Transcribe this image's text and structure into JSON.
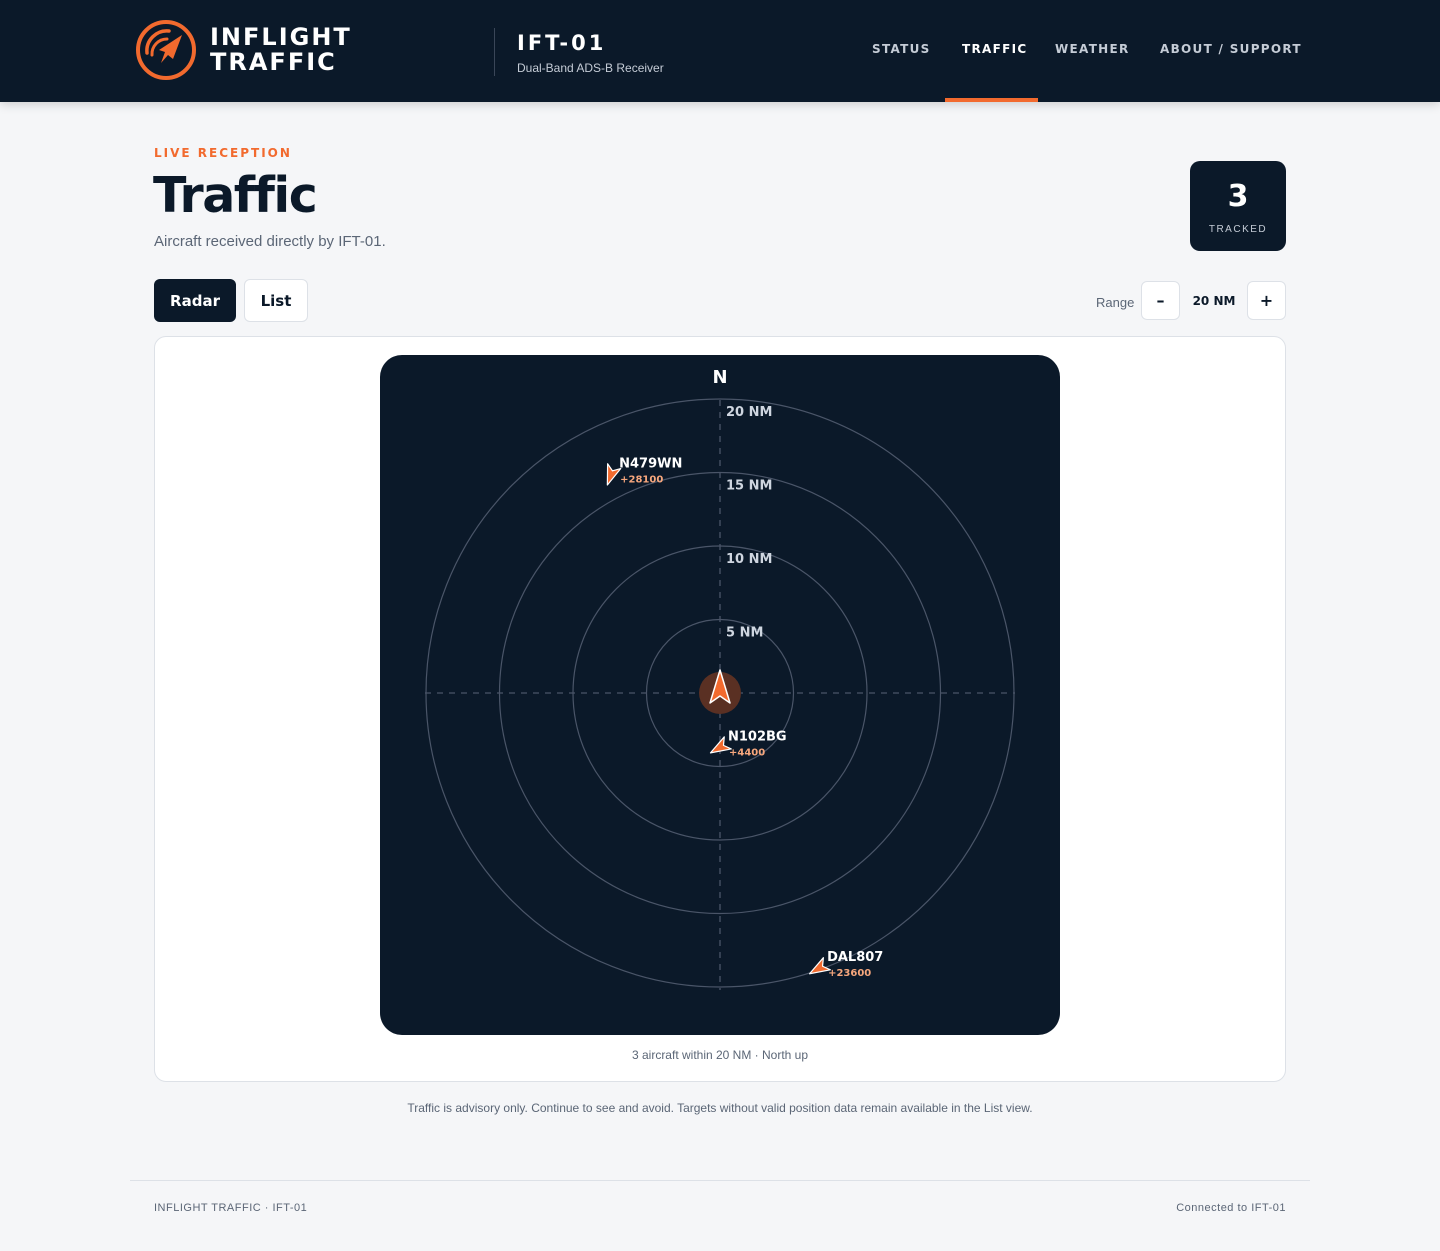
{
  "brand": {
    "line1": "INFLIGHT",
    "line2": "TRAFFIC"
  },
  "device": {
    "name": "IFT-01",
    "subtitle": "Dual-Band ADS-B Receiver"
  },
  "nav": [
    {
      "label": "STATUS",
      "active": false
    },
    {
      "label": "TRAFFIC",
      "active": true
    },
    {
      "label": "WEATHER",
      "active": false
    },
    {
      "label": "ABOUT / SUPPORT",
      "active": false
    }
  ],
  "page": {
    "eyebrow": "LIVE RECEPTION",
    "title": "Traffic",
    "subtitle": "Aircraft received directly by IFT-01."
  },
  "tracked": {
    "count": "3",
    "label": "TRACKED"
  },
  "tabs": {
    "radar": "Radar",
    "list": "List"
  },
  "range": {
    "label": "Range",
    "decrease": "–",
    "value": "20 NM",
    "increase": "+",
    "max_nm": 20
  },
  "radar": {
    "north": "N",
    "rings": [
      {
        "nm": 5,
        "label": "5 NM"
      },
      {
        "nm": 10,
        "label": "10 NM"
      },
      {
        "nm": 15,
        "label": "15 NM"
      },
      {
        "nm": 20,
        "label": "20 NM"
      }
    ],
    "aircraft": [
      {
        "callsign": "N479WN",
        "altitude": "+28100",
        "bearing_deg": 333.5,
        "distance_nm": 16.6,
        "track_deg": 200
      },
      {
        "callsign": "N102BG",
        "altitude": "+4400",
        "bearing_deg": 180,
        "distance_nm": 3.7,
        "track_deg": 240
      },
      {
        "callsign": "DAL807",
        "altitude": "+23600",
        "bearing_deg": 160.2,
        "distance_nm": 19.9,
        "track_deg": 240
      }
    ],
    "colors": {
      "background": "#0b1929",
      "ring": "#4a5568",
      "aircraft": "#f26a2e",
      "altitude": "#f7a77d",
      "ownship_halo": "#5a3023"
    }
  },
  "caption": "3 aircraft within 20 NM · North up",
  "advisory": "Traffic is advisory only. Continue to see and avoid. Targets without valid position data remain available in the List view.",
  "footer": {
    "left": "INFLIGHT TRAFFIC · IFT-01",
    "right": "Connected to IFT-01"
  }
}
